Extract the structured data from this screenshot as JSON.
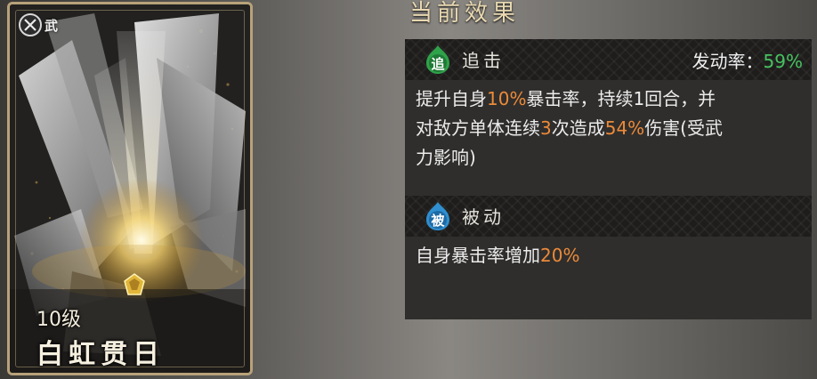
{
  "card": {
    "weapon_label": "武",
    "level": "10级",
    "name": "白虹贯日"
  },
  "section_title": "当前效果",
  "skills": [
    {
      "type_icon_char": "追",
      "type_label": "追击",
      "rate_label": "发动率：",
      "rate_value": "59%",
      "description": {
        "p1": "提升自身",
        "v1": "10%",
        "p2": "暴击率，持续1回合，并",
        "p3": "对敌方单体连续",
        "v2": "3",
        "p4": "次造成",
        "v3": "54%",
        "p5": "伤害(受武",
        "p6": "力影响)"
      }
    },
    {
      "type_icon_char": "被",
      "type_label": "被动",
      "description": {
        "p1": "自身暴击率增加",
        "v1": "20%"
      }
    }
  ],
  "colors": {
    "highlight": "#ec8a3a",
    "rate_green": "#47c25f",
    "pursuit_icon": "#2fa24a",
    "passive_icon": "#2f8fd0",
    "card_border": "#b8a27a"
  }
}
